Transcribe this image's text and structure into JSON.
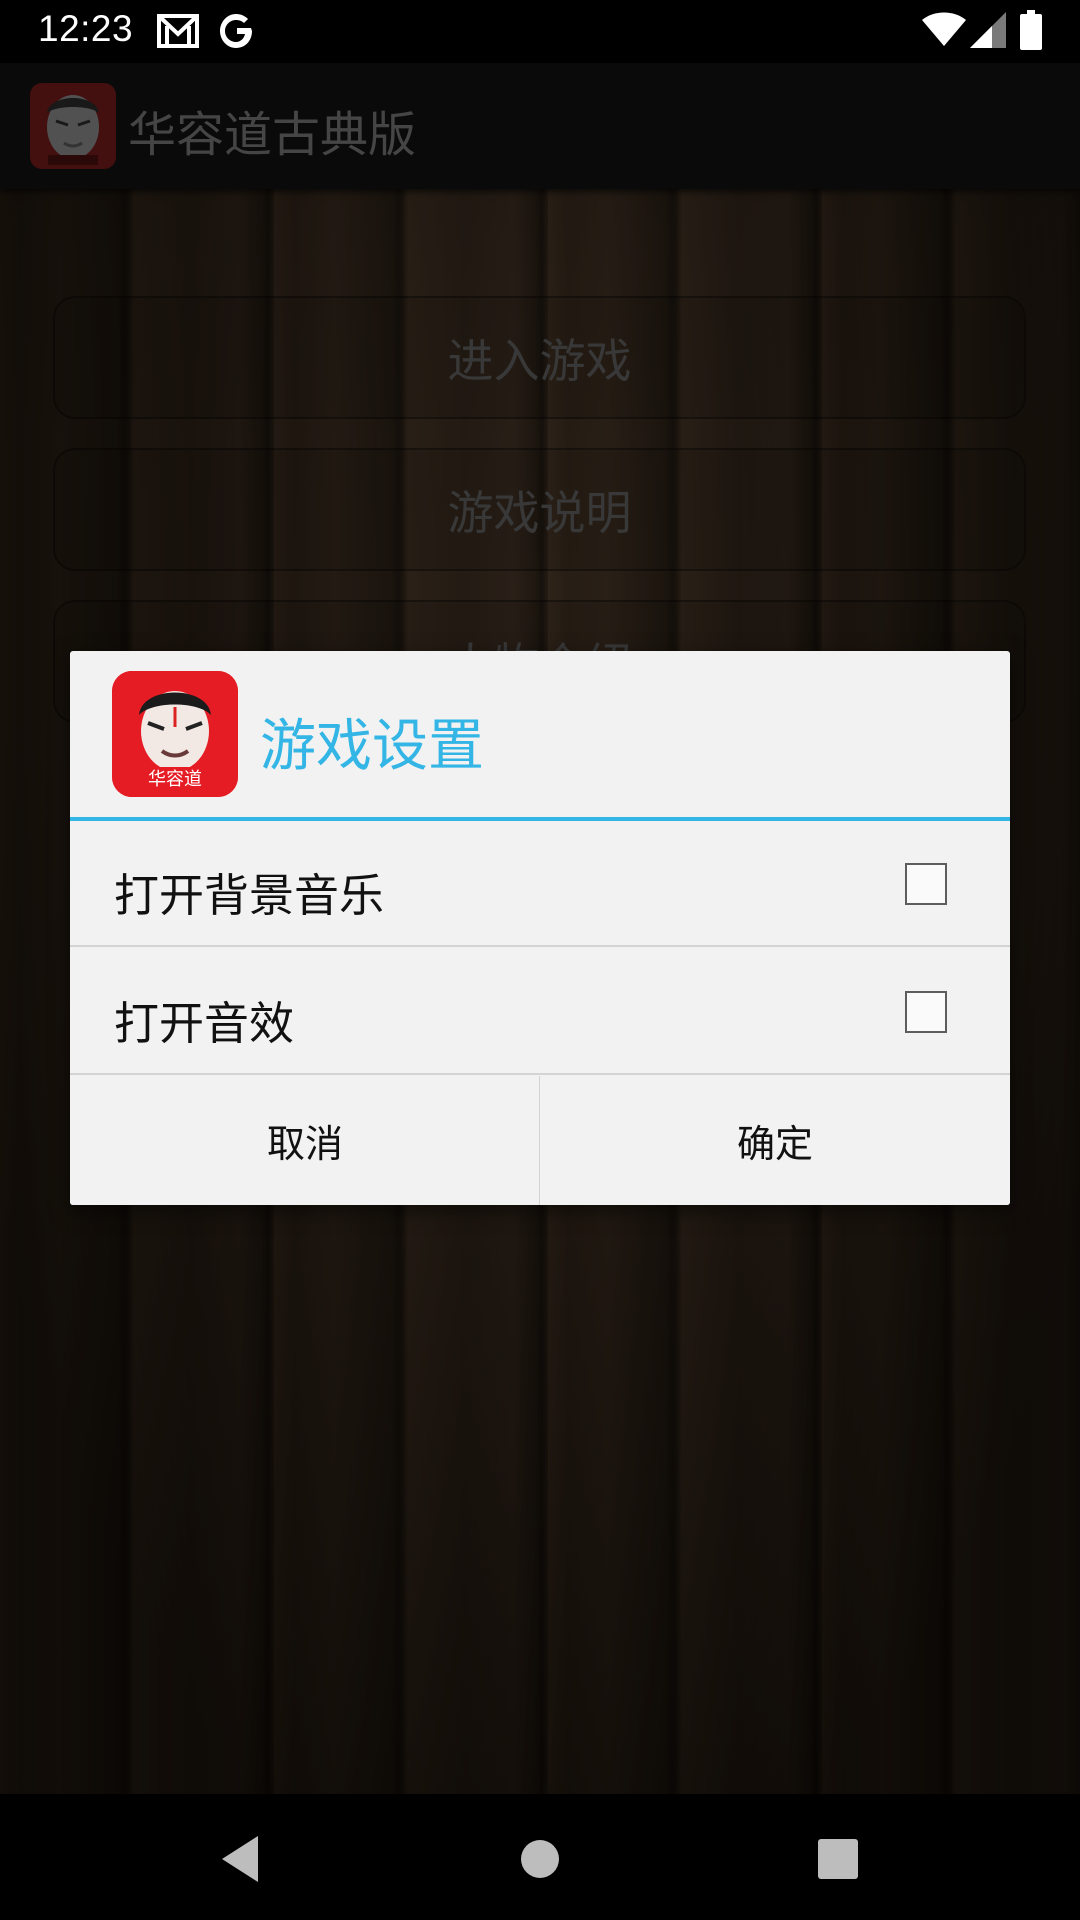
{
  "status_bar": {
    "time": "12:23",
    "icons": [
      "gmail-icon",
      "google-icon",
      "wifi-icon",
      "signal-icon",
      "battery-icon"
    ]
  },
  "app_bar": {
    "title": "华容道古典版"
  },
  "menu": {
    "items": [
      "进入游戏",
      "游戏说明",
      "人物介绍"
    ]
  },
  "dialog": {
    "title": "游戏设置",
    "options": [
      {
        "label": "打开背景音乐",
        "checked": false
      },
      {
        "label": "打开音效",
        "checked": false
      }
    ],
    "cancel_label": "取消",
    "confirm_label": "确定",
    "logo_text": "华容道"
  },
  "colors": {
    "accent": "#33b5e5",
    "logo_red": "#e51c24"
  },
  "nav_bar": {
    "icons": [
      "back-icon",
      "home-icon",
      "recents-icon"
    ]
  }
}
